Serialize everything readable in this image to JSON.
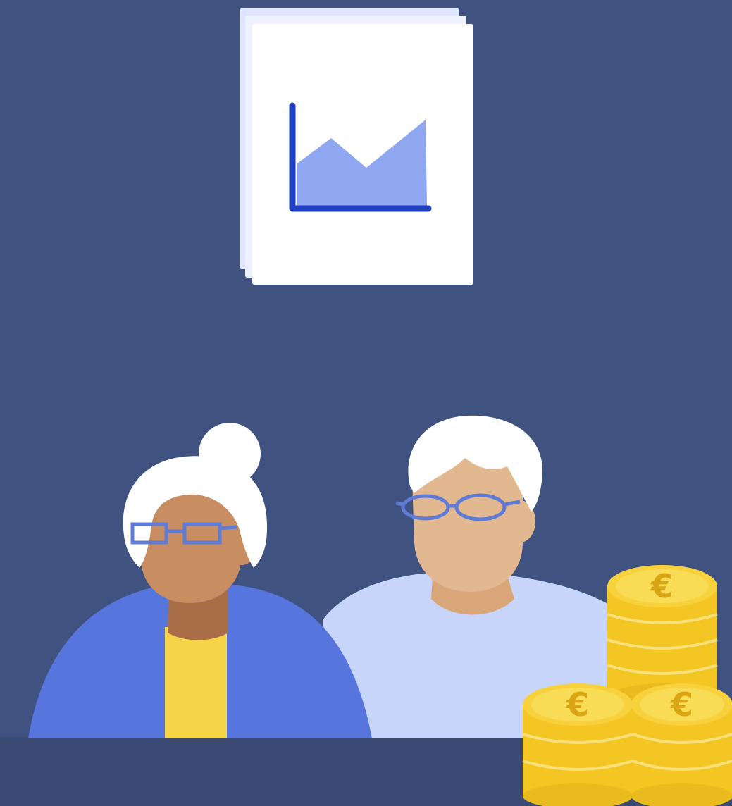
{
  "scene": {
    "subject": "illustration",
    "elements": [
      "document-chart-icon",
      "older-woman-figure",
      "older-man-figure",
      "coin-stacks"
    ]
  },
  "colors": {
    "background": "#3f5280",
    "table": "#3a4a74",
    "paper": "#ffffff",
    "paper_back": "#dfe6ff",
    "chart_axis": "#1e3fbf",
    "chart_area": "#8fa6f0",
    "woman_jacket": "#5676de",
    "woman_shirt": "#f6d44a",
    "woman_skin": "#c98d62",
    "woman_neck": "#a96e47",
    "man_shirt": "#c7d5fb",
    "man_skin": "#e2b891",
    "hair": "#ffffff",
    "glasses": "#5f7bd6",
    "coin_face": "#f7d23c",
    "coin_edge": "#e9bb1f",
    "coin_symbol": "#d9a514"
  },
  "icons": {
    "document": "line-area-chart-page",
    "coin": "euro-coin"
  },
  "coin_symbol": "€"
}
